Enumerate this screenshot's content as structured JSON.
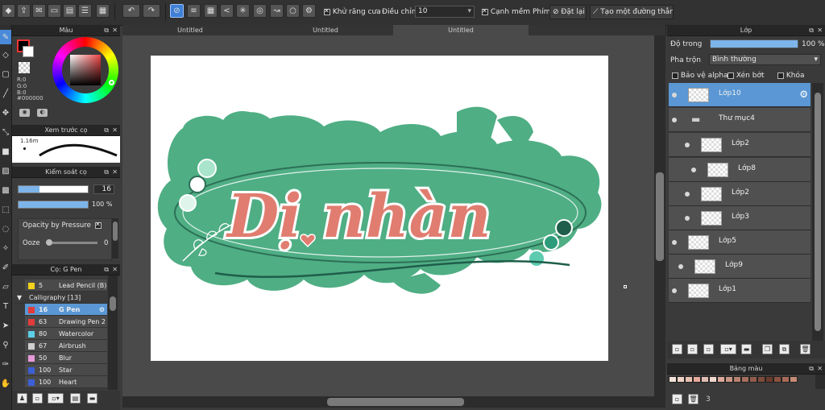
{
  "toolbar": {
    "antialias_label": "Khử răng cưa",
    "adjust_label": "Điều chỉnh",
    "adjust_value": "10",
    "soft_edge_label": "Cạnh mềm",
    "key_label": "Phím",
    "reset_label": "Đặt lại",
    "straight_line_label": "Tạo một đường thẳng"
  },
  "tabs": [
    "Untitled",
    "Untitled",
    "Untitled"
  ],
  "color_panel": {
    "title": "Màu",
    "r": "R:0",
    "g": "G:0",
    "b": "B:0",
    "hex": "#000000"
  },
  "brush_preview": {
    "title": "Xem trước cọ",
    "size": "1.16m"
  },
  "brush_control": {
    "title": "Kiểm soát cọ",
    "size_value": "16",
    "opacity_value": "100 %",
    "opacity_pressure_label": "Opacity by Pressure",
    "ooze_label": "Ooze",
    "ooze_value": "0"
  },
  "brush_list": {
    "title": "Cọ: G Pen",
    "category": "Calligraphy [13]",
    "items": [
      {
        "size": "5",
        "name": "Lead Pencil (B)",
        "color": "#f2d21b"
      },
      {
        "size": "16",
        "name": "G Pen",
        "color": "#e23b3b"
      },
      {
        "size": "63",
        "name": "Drawing Pen 2",
        "color": "#e23b3b"
      },
      {
        "size": "80",
        "name": "Watercolor",
        "color": "#5ccfe8"
      },
      {
        "size": "67",
        "name": "Airbrush",
        "color": "#cfcfcf"
      },
      {
        "size": "50",
        "name": "Blur",
        "color": "#e79ad8"
      },
      {
        "size": "100",
        "name": "Star",
        "color": "#3c5fd6"
      },
      {
        "size": "100",
        "name": "Heart",
        "color": "#3c5fd6"
      }
    ]
  },
  "layers_panel": {
    "title": "Lớp",
    "opacity_label": "Độ trong",
    "opacity_value": "100 %",
    "blend_label": "Pha trộn",
    "blend_value": "Bình thường",
    "protect_alpha_label": "Bảo vệ alpha",
    "clipping_label": "Xén bớt",
    "lock_label": "Khóa",
    "layers": [
      {
        "name": "Lớp10",
        "selected": true
      },
      {
        "name": "Thư mục4",
        "folder": true
      },
      {
        "name": "Lớp2"
      },
      {
        "name": "Lớp8"
      },
      {
        "name": "Lớp2"
      },
      {
        "name": "Lớp3"
      },
      {
        "name": "Lớp5"
      },
      {
        "name": "Lớp9"
      },
      {
        "name": "Lớp1"
      }
    ]
  },
  "palette_panel": {
    "title": "Bảng màu",
    "count": "3",
    "colors": [
      "#f3e2d8",
      "#efd2c4",
      "#e8c0b0",
      "#e7a99b",
      "#e0bdb3",
      "#f2d7cf",
      "#dca99a",
      "#c99585",
      "#b7816f",
      "#a56e5d",
      "#925c4c",
      "#7e4b3c",
      "#6b3b2d",
      "#8a5240",
      "#a86a57",
      "#c68a75"
    ]
  },
  "artwork": {
    "title": "Dị nhàn"
  }
}
